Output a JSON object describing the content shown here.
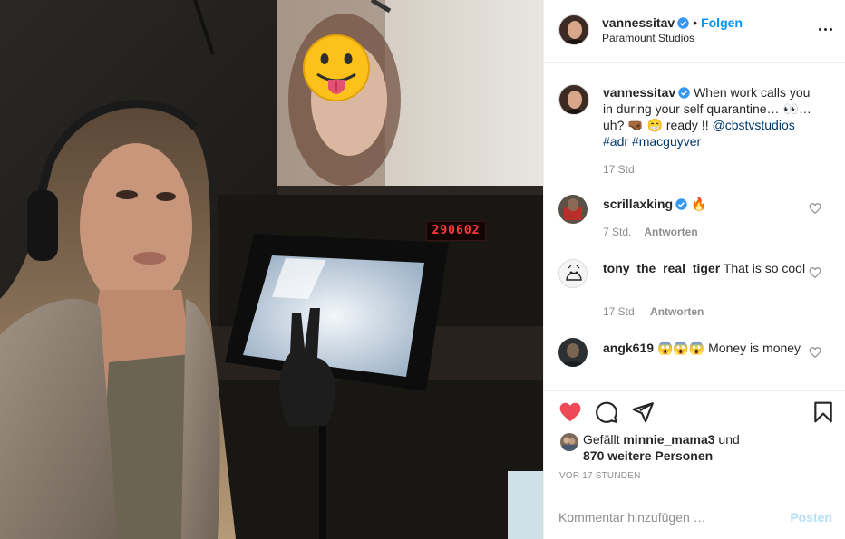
{
  "photo": {
    "counter_display": "290602",
    "sticker_emoji": "😛"
  },
  "header": {
    "username": "vannessitav",
    "separator": "•",
    "follow_label": "Folgen",
    "location": "Paramount Studios"
  },
  "caption": {
    "username": "vannessitav",
    "text_1": "When work calls you in during your self quarantine… 👀…uh? 🤜🏾 😁 ready !!",
    "mention": "@cbstvstudios",
    "hashtag_1": "#adr",
    "hashtag_2": "#macguyver",
    "time": "17 Std."
  },
  "comments": [
    {
      "username": "scrillaxking",
      "text": "🔥",
      "time": "7 Std.",
      "reply_label": "Antworten"
    },
    {
      "username": "tony_the_real_tiger",
      "text": "That is so cool",
      "time": "17 Std.",
      "reply_label": "Antworten"
    },
    {
      "username": "angk619",
      "text": "😱😱😱 Money is money"
    }
  ],
  "likes": {
    "prefix": "Gefällt",
    "user": "minnie_mama3",
    "conj": "und",
    "others": "870 weitere Personen"
  },
  "timestamp": "VOR 17 STUNDEN",
  "add_comment": {
    "placeholder": "Kommentar hinzufügen …",
    "post_label": "Posten"
  },
  "colors": {
    "accent": "#0095f6",
    "like_red": "#ed4956",
    "verified": "#3897f0",
    "post_disabled": "#b2dffc"
  },
  "icons": {
    "more": "more-options-icon",
    "verified": "verified-badge-icon",
    "like": "heart-filled-icon",
    "comment": "comment-bubble-icon",
    "share": "paper-plane-icon",
    "save": "bookmark-icon",
    "comment_like": "heart-outline-icon"
  }
}
